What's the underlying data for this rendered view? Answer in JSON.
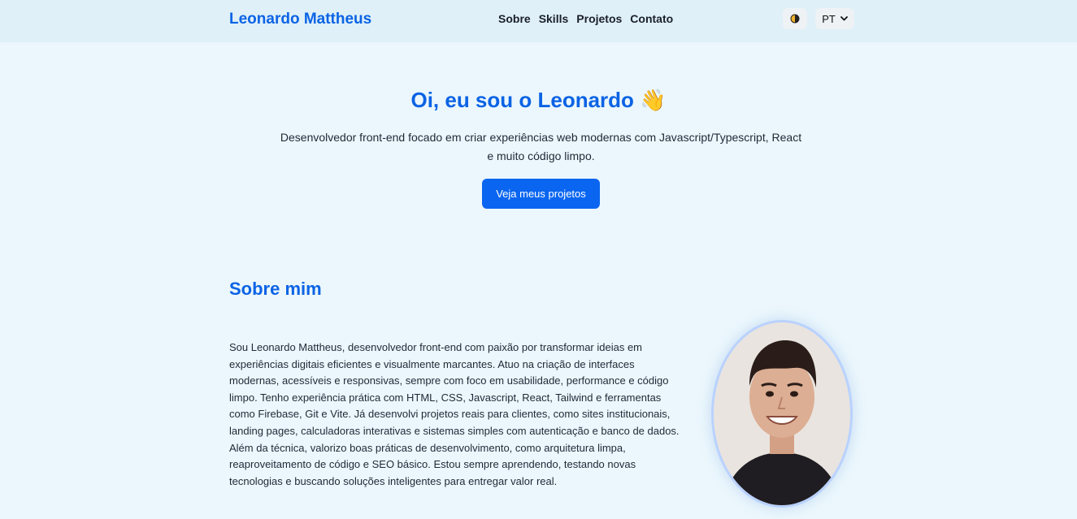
{
  "header": {
    "brand": "Leonardo Mattheus",
    "nav": [
      "Sobre",
      "Skills",
      "Projetos",
      "Contato"
    ],
    "theme_icon": "half-circle-icon",
    "language": "PT"
  },
  "hero": {
    "title": "Oi, eu sou o Leonardo 👋",
    "text": "Desenvolvedor front-end focado em criar experiências web modernas com Javascript/Typescript, React e muito código limpo.",
    "cta": "Veja meus projetos"
  },
  "about": {
    "title": "Sobre mim",
    "text": "Sou Leonardo Mattheus, desenvolvedor front-end com paixão por transformar ideias em experiências digitais eficientes e visualmente marcantes. Atuo na criação de interfaces modernas, acessíveis e responsivas, sempre com foco em usabilidade, performance e código limpo. Tenho experiência prática com HTML, CSS, Javascript, React, Tailwind e ferramentas como Firebase, Git e Vite. Já desenvolvi projetos reais para clientes, como sites institucionais, landing pages, calculadoras interativas e sistemas simples com autenticação e banco de dados. Além da técnica, valorizo boas práticas de desenvolvimento, como arquitetura limpa, reaproveitamento de código e SEO básico. Estou sempre aprendendo, testando novas tecnologias e buscando soluções inteligentes para entregar valor real."
  },
  "colors": {
    "accent": "#0b63e5",
    "button": "#0a66f0",
    "background": "#ebf7fc",
    "header": "#dff0f8"
  }
}
